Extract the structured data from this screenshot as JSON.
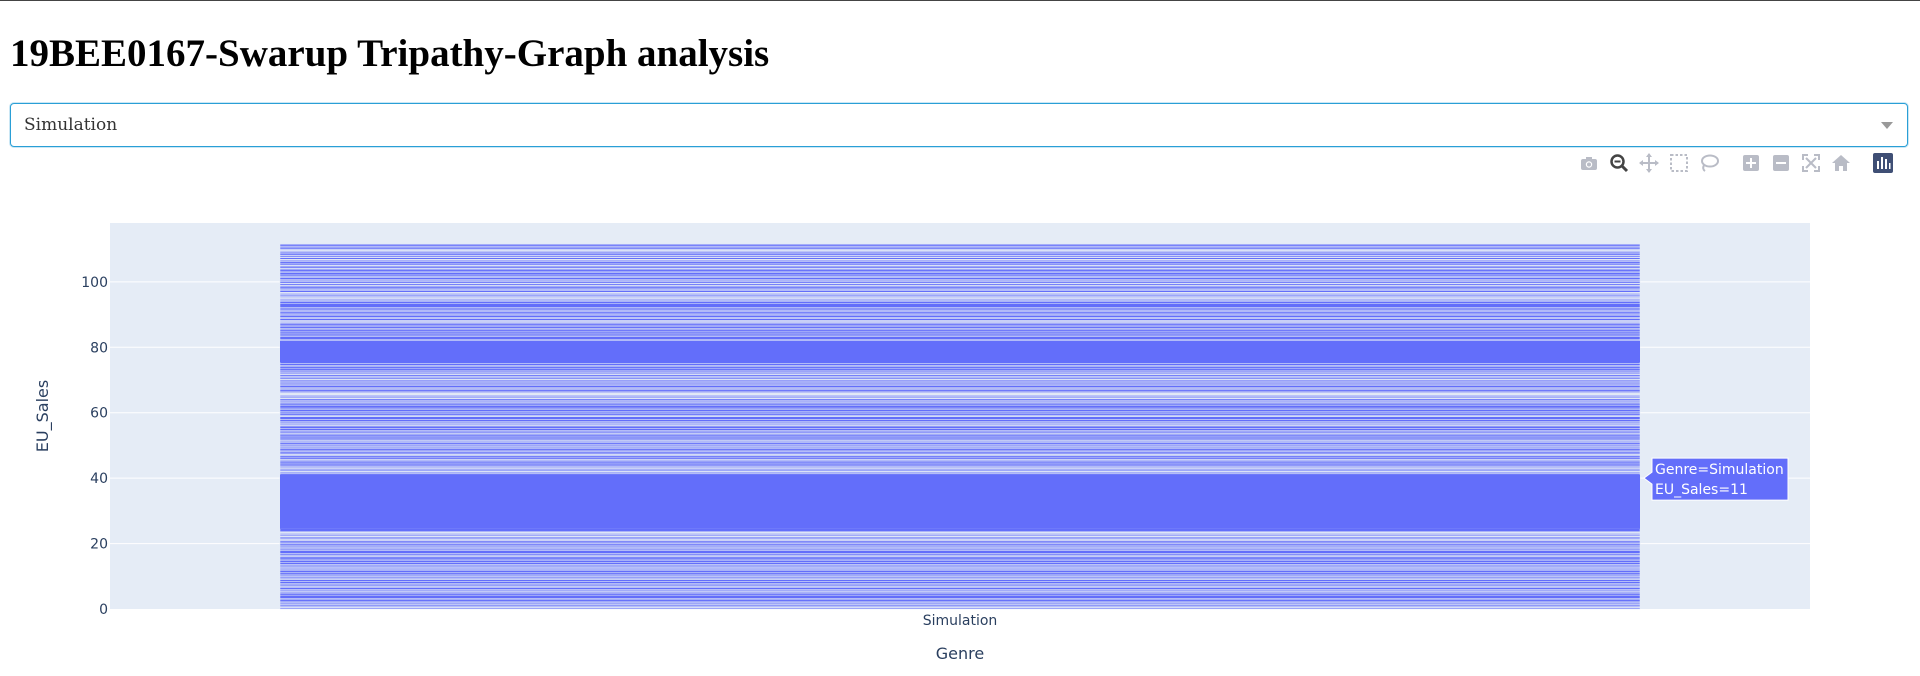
{
  "page": {
    "title": "19BEE0167-Swarup Tripathy-Graph analysis"
  },
  "dropdown": {
    "selected": "Simulation"
  },
  "modebar": {
    "buttons": [
      {
        "icon": "camera-icon",
        "active": false
      },
      {
        "icon": "zoom-icon",
        "active": true
      },
      {
        "icon": "pan-icon",
        "active": false
      },
      {
        "icon": "box-select-icon",
        "active": false
      },
      {
        "icon": "lasso-select-icon",
        "active": false
      },
      {
        "icon": "zoom-in-icon",
        "active": false
      },
      {
        "icon": "zoom-out-icon",
        "active": false
      },
      {
        "icon": "autoscale-icon",
        "active": false
      },
      {
        "icon": "reset-axes-icon",
        "active": false
      },
      {
        "icon": "plotly-logo-icon",
        "active": false
      }
    ]
  },
  "chart_data": {
    "type": "bar",
    "barmode": "stacked",
    "categories": [
      "Simulation"
    ],
    "xlabel": "Genre",
    "ylabel": "EU_Sales",
    "ylim": [
      0,
      118
    ],
    "yticks": [
      0,
      20,
      40,
      60,
      80,
      100
    ],
    "grid": true,
    "bar_color": "#636efa",
    "plot_bg": "#e5ecf6",
    "stack_total": 112,
    "dense_segments": [
      {
        "from": 24.5,
        "to": 41
      },
      {
        "from": 75.5,
        "to": 82
      }
    ],
    "hover": {
      "lines": [
        "Genre=Simulation",
        "EU_Sales=11"
      ],
      "y": 40
    }
  }
}
